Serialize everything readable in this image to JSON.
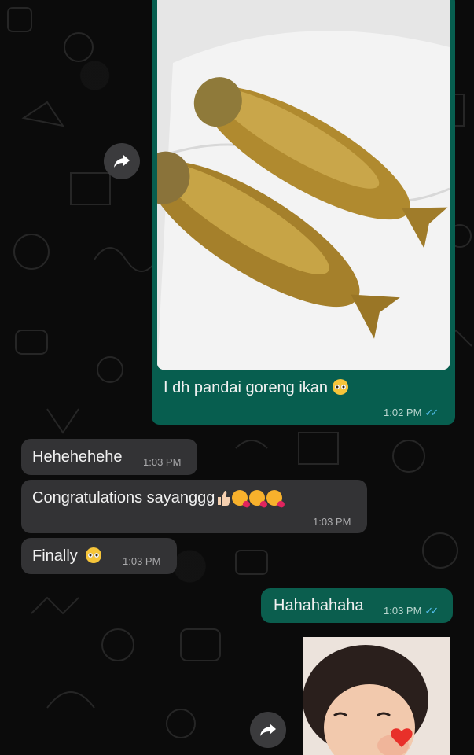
{
  "messages": {
    "outgoing_image": {
      "caption": "I dh pandai goreng ikan",
      "time": "1:02 PM"
    },
    "incoming_1": {
      "text": "Hehehehehe",
      "time": "1:03 PM"
    },
    "incoming_2": {
      "text": "Congratulations sayanggg",
      "time": "1:03 PM"
    },
    "incoming_3": {
      "text": "Finally",
      "time": "1:03 PM"
    },
    "outgoing_text": {
      "text": "Hahahahaha",
      "time": "1:03 PM"
    }
  },
  "icons": {
    "forward": "forward-arrow-icon",
    "read_receipt": "double-check-icon",
    "pleading_face": "pleading-face-emoji",
    "thumbs_up": "thumbs-up-emoji",
    "kissing_face": "face-blowing-kiss-emoji"
  },
  "colors": {
    "background": "#0b0b0b",
    "outgoing_bubble": "#075e4f",
    "incoming_bubble": "#333335",
    "read_ticks": "#53bdeb"
  }
}
